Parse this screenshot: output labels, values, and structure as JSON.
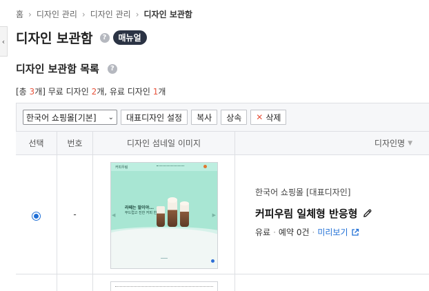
{
  "breadcrumb": {
    "home": "홈",
    "items": [
      "디자인 관리",
      "디자인 관리"
    ],
    "current": "디자인 보관함"
  },
  "page": {
    "title": "디자인 보관함",
    "help_icon": "?",
    "manual_label": "매뉴얼"
  },
  "section": {
    "title": "디자인 보관함 목록",
    "help_icon": "?"
  },
  "summary": {
    "prefix": "[총 ",
    "total": "3",
    "mid1": "개] 무료 디자인 ",
    "free": "2",
    "mid2": "개, 유료 디자인 ",
    "paid": "1",
    "suffix": "개"
  },
  "toolbar": {
    "shop_select_value": "한국어 쇼핑몰[기본]",
    "set_default_label": "대표디자인 설정",
    "copy_label": "복사",
    "inherit_label": "상속",
    "delete_icon": "✕",
    "delete_label": "삭제"
  },
  "table": {
    "headers": {
      "select": "선택",
      "number": "번호",
      "thumbnail": "디자인 섬네일 이미지",
      "name": "디자인명"
    },
    "rows": [
      {
        "selected": true,
        "number": "-",
        "thumbnail": {
          "logo": "커피우림",
          "headline": "라떼는 말이야...",
          "subline": "부드럽고 진한 커피 한 잔"
        },
        "shop_label": "한국어 쇼핑몰 [대표디자인]",
        "design_name": "커피우림 일체형 반응형",
        "price_type": "유료",
        "reservation": "예약 0건",
        "preview_label": "미리보기"
      }
    ]
  },
  "colors": {
    "accent_blue": "#1f6fd6",
    "accent_red": "#e8533c",
    "badge_dark": "#2b3344",
    "thumbnail_mint": "#a8e6d3"
  },
  "icons": {
    "side_toggle": "chevron-left-icon",
    "breadcrumb_sep": "chevron-right-icon",
    "edit": "pencil-icon",
    "external": "external-link-icon",
    "sort": "sort-down-icon"
  }
}
